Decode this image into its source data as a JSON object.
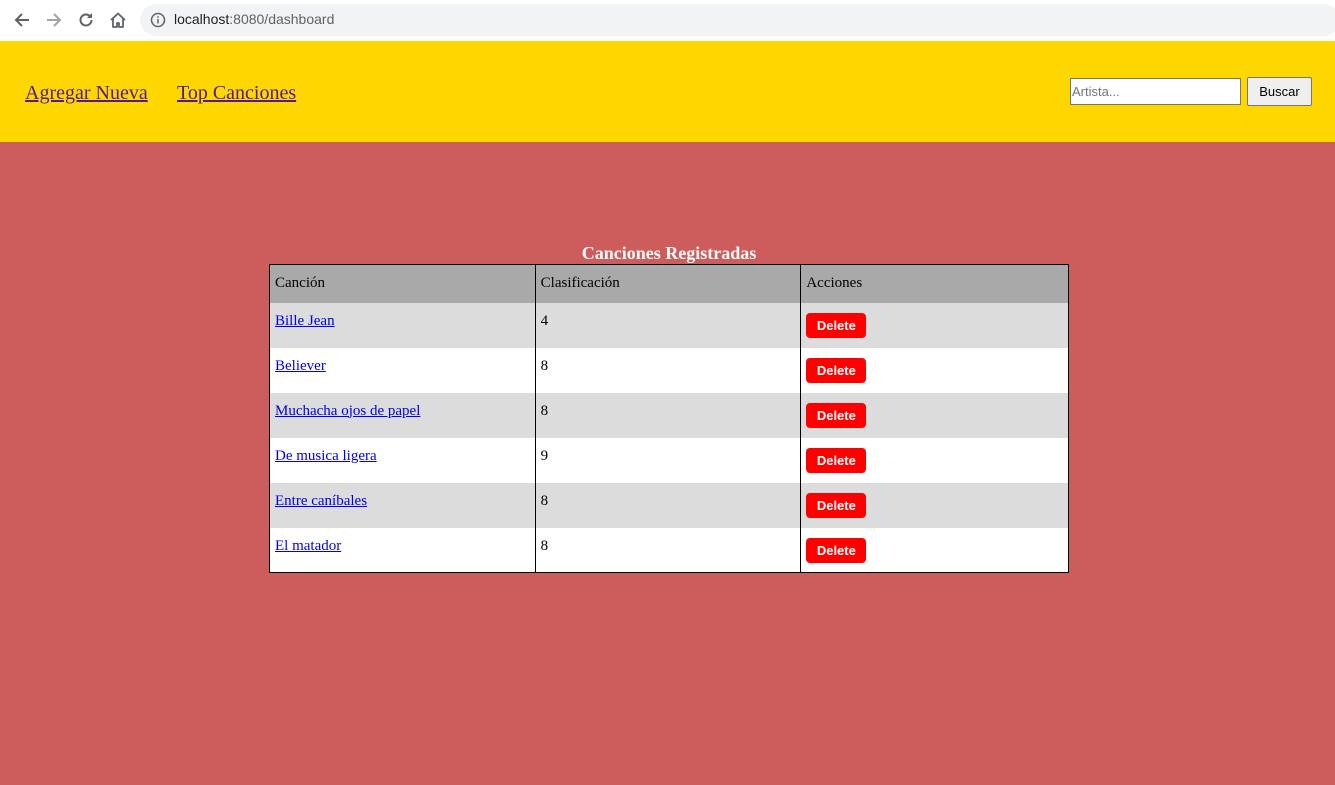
{
  "browser": {
    "url_host": "localhost",
    "url_rest": ":8080/dashboard"
  },
  "header": {
    "links": [
      "Agregar Nueva",
      "Top Canciones"
    ],
    "search": {
      "placeholder": "Artista...",
      "value": "",
      "button_label": "Buscar"
    }
  },
  "table": {
    "caption": "Canciones Registradas",
    "columns": [
      "Canción",
      "Clasificación",
      "Acciones"
    ],
    "rows": [
      {
        "song": "Bille Jean",
        "rating": "4",
        "action": "Delete"
      },
      {
        "song": "Believer",
        "rating": "8",
        "action": "Delete"
      },
      {
        "song": "Muchacha ojos de papel",
        "rating": "8",
        "action": "Delete"
      },
      {
        "song": "De musica ligera",
        "rating": "9",
        "action": "Delete"
      },
      {
        "song": "Entre caníbales",
        "rating": "8",
        "action": "Delete"
      },
      {
        "song": "El matador",
        "rating": "8",
        "action": "Delete"
      }
    ]
  },
  "colors": {
    "page_bg": "#cd5c5c",
    "header_bg": "#ffd700",
    "delete_button": "#ff0000",
    "table_header": "#a9a9a9",
    "row_alt": "#dcdcdc"
  },
  "icons": [
    "back-arrow-icon",
    "forward-arrow-icon",
    "reload-icon",
    "home-icon",
    "info-icon"
  ]
}
